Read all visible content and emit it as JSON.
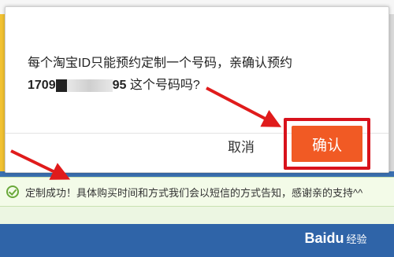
{
  "dialog": {
    "message_line1": "每个淘宝ID只能预约定制一个号码，亲确认预约",
    "number_prefix": "1709",
    "number_suffix": "95",
    "message_line2_tail": " 这个号码吗?",
    "cancel_label": "取消",
    "confirm_label": "确认"
  },
  "notification": {
    "text": "定制成功！具体购买时间和方式我们会以短信的方式告知，感谢亲的支持^^"
  },
  "watermark": {
    "brand": "Baidu",
    "sub": "经验"
  },
  "colors": {
    "confirm_button": "#f15a24",
    "highlight_frame": "#d8121c",
    "success_check": "#6aa83a",
    "arrow": "#e01b1b"
  }
}
